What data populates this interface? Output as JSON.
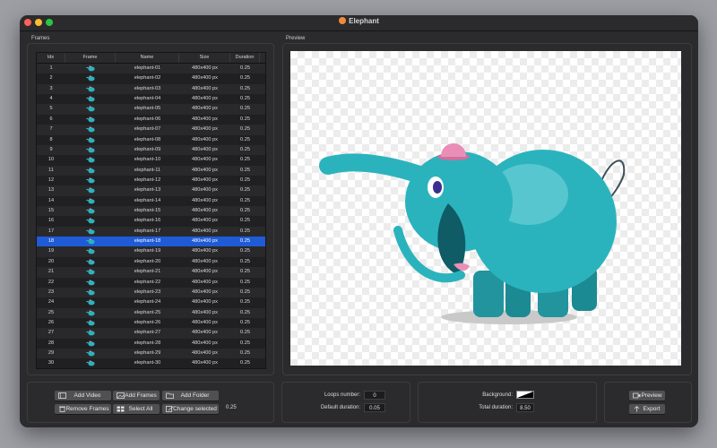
{
  "window": {
    "title": "Elephant"
  },
  "frames_group": {
    "label": "Frames",
    "columns": [
      "Idx",
      "Frame",
      "Name",
      "Size",
      "Duration"
    ],
    "rows": [
      {
        "idx": "1",
        "name": "elephant-01",
        "size": "480x400 px",
        "duration": "0.25"
      },
      {
        "idx": "2",
        "name": "elephant-02",
        "size": "480x400 px",
        "duration": "0.25"
      },
      {
        "idx": "3",
        "name": "elephant-03",
        "size": "480x400 px",
        "duration": "0.25"
      },
      {
        "idx": "4",
        "name": "elephant-04",
        "size": "480x400 px",
        "duration": "0.25"
      },
      {
        "idx": "5",
        "name": "elephant-05",
        "size": "480x400 px",
        "duration": "0.25"
      },
      {
        "idx": "6",
        "name": "elephant-06",
        "size": "480x400 px",
        "duration": "0.25"
      },
      {
        "idx": "7",
        "name": "elephant-07",
        "size": "480x400 px",
        "duration": "0.25"
      },
      {
        "idx": "8",
        "name": "elephant-08",
        "size": "480x400 px",
        "duration": "0.25"
      },
      {
        "idx": "9",
        "name": "elephant-09",
        "size": "480x400 px",
        "duration": "0.25"
      },
      {
        "idx": "10",
        "name": "elephant-10",
        "size": "480x400 px",
        "duration": "0.25"
      },
      {
        "idx": "11",
        "name": "elephant-11",
        "size": "480x400 px",
        "duration": "0.25"
      },
      {
        "idx": "12",
        "name": "elephant-12",
        "size": "480x400 px",
        "duration": "0.25"
      },
      {
        "idx": "13",
        "name": "elephant-13",
        "size": "480x400 px",
        "duration": "0.25"
      },
      {
        "idx": "14",
        "name": "elephant-14",
        "size": "480x400 px",
        "duration": "0.25"
      },
      {
        "idx": "15",
        "name": "elephant-15",
        "size": "480x400 px",
        "duration": "0.25"
      },
      {
        "idx": "16",
        "name": "elephant-16",
        "size": "480x400 px",
        "duration": "0.25"
      },
      {
        "idx": "17",
        "name": "elephant-17",
        "size": "480x400 px",
        "duration": "0.25"
      },
      {
        "idx": "18",
        "name": "elephant-18",
        "size": "480x400 px",
        "duration": "0.25"
      },
      {
        "idx": "19",
        "name": "elephant-19",
        "size": "480x400 px",
        "duration": "0.25"
      },
      {
        "idx": "20",
        "name": "elephant-20",
        "size": "480x400 px",
        "duration": "0.25"
      },
      {
        "idx": "21",
        "name": "elephant-21",
        "size": "480x400 px",
        "duration": "0.25"
      },
      {
        "idx": "22",
        "name": "elephant-22",
        "size": "480x400 px",
        "duration": "0.25"
      },
      {
        "idx": "23",
        "name": "elephant-23",
        "size": "480x400 px",
        "duration": "0.25"
      },
      {
        "idx": "24",
        "name": "elephant-24",
        "size": "480x400 px",
        "duration": "0.25"
      },
      {
        "idx": "25",
        "name": "elephant-25",
        "size": "480x400 px",
        "duration": "0.25"
      },
      {
        "idx": "26",
        "name": "elephant-26",
        "size": "480x400 px",
        "duration": "0.25"
      },
      {
        "idx": "27",
        "name": "elephant-27",
        "size": "480x400 px",
        "duration": "0.25"
      },
      {
        "idx": "28",
        "name": "elephant-28",
        "size": "480x400 px",
        "duration": "0.25"
      },
      {
        "idx": "29",
        "name": "elephant-29",
        "size": "480x400 px",
        "duration": "0.25"
      },
      {
        "idx": "30",
        "name": "elephant-30",
        "size": "480x400 px",
        "duration": "0.25"
      }
    ],
    "selected_row": "18",
    "thumbnail_icon": "elephant-thumbnail-icon"
  },
  "preview_group": {
    "label": "Preview",
    "image_content": "elephant-illustration",
    "image_colors": {
      "body": "#2bb3bd",
      "hat": "#e98fb7",
      "shadow": "#c9c9c9"
    }
  },
  "frame_actions": {
    "add_video": "Add Video",
    "add_frames": "Add Frames",
    "add_folder": "Add Folder",
    "remove_frames": "Remove Frames",
    "select_all": "Select All",
    "change_selected": "Change selected",
    "change_value": "0.25",
    "icons": [
      "film-icon",
      "images-icon",
      "folder-icon",
      "trash-icon",
      "grid-icon",
      "edit-icon"
    ]
  },
  "loop_settings": {
    "loops_label": "Loops number:",
    "loops_value": "0",
    "default_duration_label": "Default duration:",
    "default_duration_value": "0.05"
  },
  "output_settings": {
    "background_label": "Background:",
    "total_duration_label": "Total duration:",
    "total_duration_value": "8.50"
  },
  "export_actions": {
    "preview": "Preview",
    "export": "Export",
    "icons": [
      "camera-icon",
      "upload-arrow-icon"
    ]
  },
  "colors": {
    "window_bg": "#2b2b2d",
    "selection": "#1f5bd6",
    "button_bg": "#505052"
  }
}
